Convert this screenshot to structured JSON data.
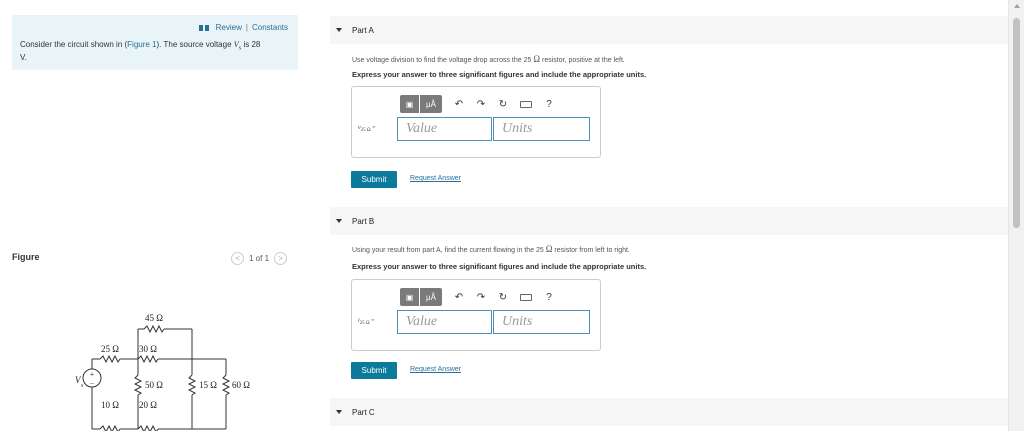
{
  "left": {
    "links": {
      "review": "Review",
      "separator": "|",
      "constants": "Constants"
    },
    "intro": {
      "prefix": "Consider the circuit shown in (",
      "figure_link": "Figure 1",
      "middle": "). The source voltage ",
      "var": "V",
      "sub": "s",
      "suffix": " is 28",
      "unit": "V",
      "period": "."
    },
    "figure_label": "Figure",
    "pager": {
      "prev": "<",
      "text": "1 of 1",
      "next": ">"
    },
    "circuit": {
      "labels": [
        "45 Ω",
        "25 Ω",
        "30 Ω",
        "50 Ω",
        "15 Ω",
        "60 Ω",
        "10 Ω",
        "20 Ω"
      ],
      "source": "V",
      "source_sub": "s",
      "plus": "+",
      "minus": "−"
    }
  },
  "parts": [
    {
      "title": "Part A",
      "question_prefix": "Use voltage division to find the voltage drop across the 25 ",
      "omega": "Ω",
      "question_suffix": " resistor, positive at the left.",
      "instruction": "Express your answer to three significant figures and include the appropriate units.",
      "var": "v",
      "var_sub": "25 Ω",
      "eq": " =",
      "value_placeholder": "Value",
      "units_placeholder": "Units",
      "submit": "Submit",
      "request": "Request Answer"
    },
    {
      "title": "Part B",
      "question_prefix": "Using your result from part A, find the current flowing in the 25 ",
      "omega": "Ω",
      "question_suffix": " resistor from left to right.",
      "instruction": "Express your answer to three significant figures and include the appropriate units.",
      "var": "i",
      "var_sub": "25 Ω",
      "eq": " =",
      "value_placeholder": "Value",
      "units_placeholder": "Units",
      "submit": "Submit",
      "request": "Request Answer"
    },
    {
      "title": "Part C"
    }
  ],
  "toolbar": {
    "template_icon": "template-icon",
    "units_btn": "μÅ",
    "undo": "↶",
    "redo": "↷",
    "reset": "↻",
    "keyboard_icon": "keyboard-icon",
    "help": "?"
  }
}
